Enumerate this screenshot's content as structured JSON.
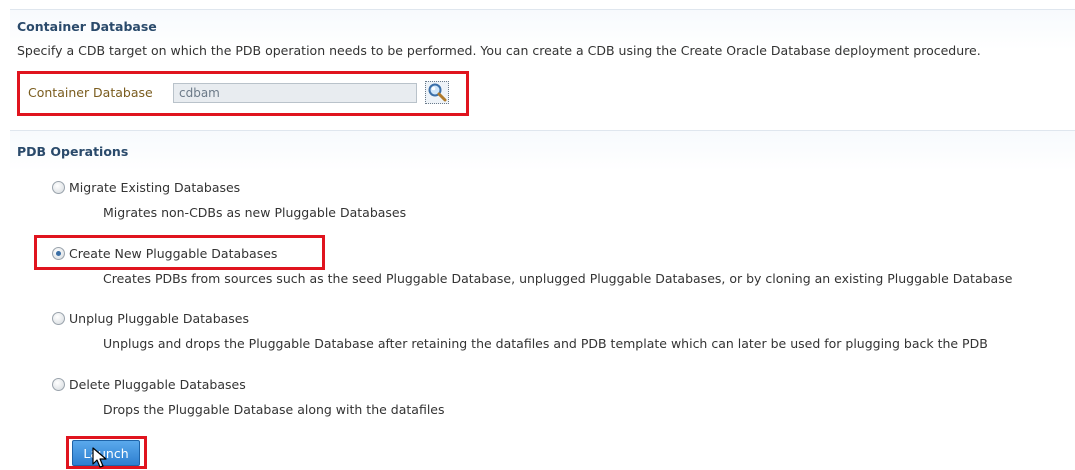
{
  "container_database": {
    "title": "Container Database",
    "description": "Specify a CDB target on which the PDB operation needs to be performed. You can create a CDB using the Create Oracle Database deployment procedure.",
    "field_label": "Container Database",
    "field_value": "cdbam",
    "search_icon": "magnifier-icon"
  },
  "pdb_operations": {
    "title": "PDB Operations",
    "selected": "create",
    "options": [
      {
        "id": "migrate",
        "label": "Migrate Existing Databases",
        "description": "Migrates non-CDBs as new Pluggable Databases"
      },
      {
        "id": "create",
        "label": "Create New Pluggable Databases",
        "description": "Creates PDBs from sources such as the seed Pluggable Database, unplugged Pluggable Databases, or by cloning an existing Pluggable Database"
      },
      {
        "id": "unplug",
        "label": "Unplug Pluggable Databases",
        "description": "Unplugs and drops the Pluggable Database after retaining the datafiles and PDB template which can later be used for plugging back the PDB"
      },
      {
        "id": "delete",
        "label": "Delete Pluggable Databases",
        "description": "Drops the Pluggable Database along with the datafiles"
      }
    ]
  },
  "launch_label": "Launch",
  "colors": {
    "highlight": "#e0141e",
    "section_title": "#2a4a6b",
    "button": "#2e7fd0"
  }
}
